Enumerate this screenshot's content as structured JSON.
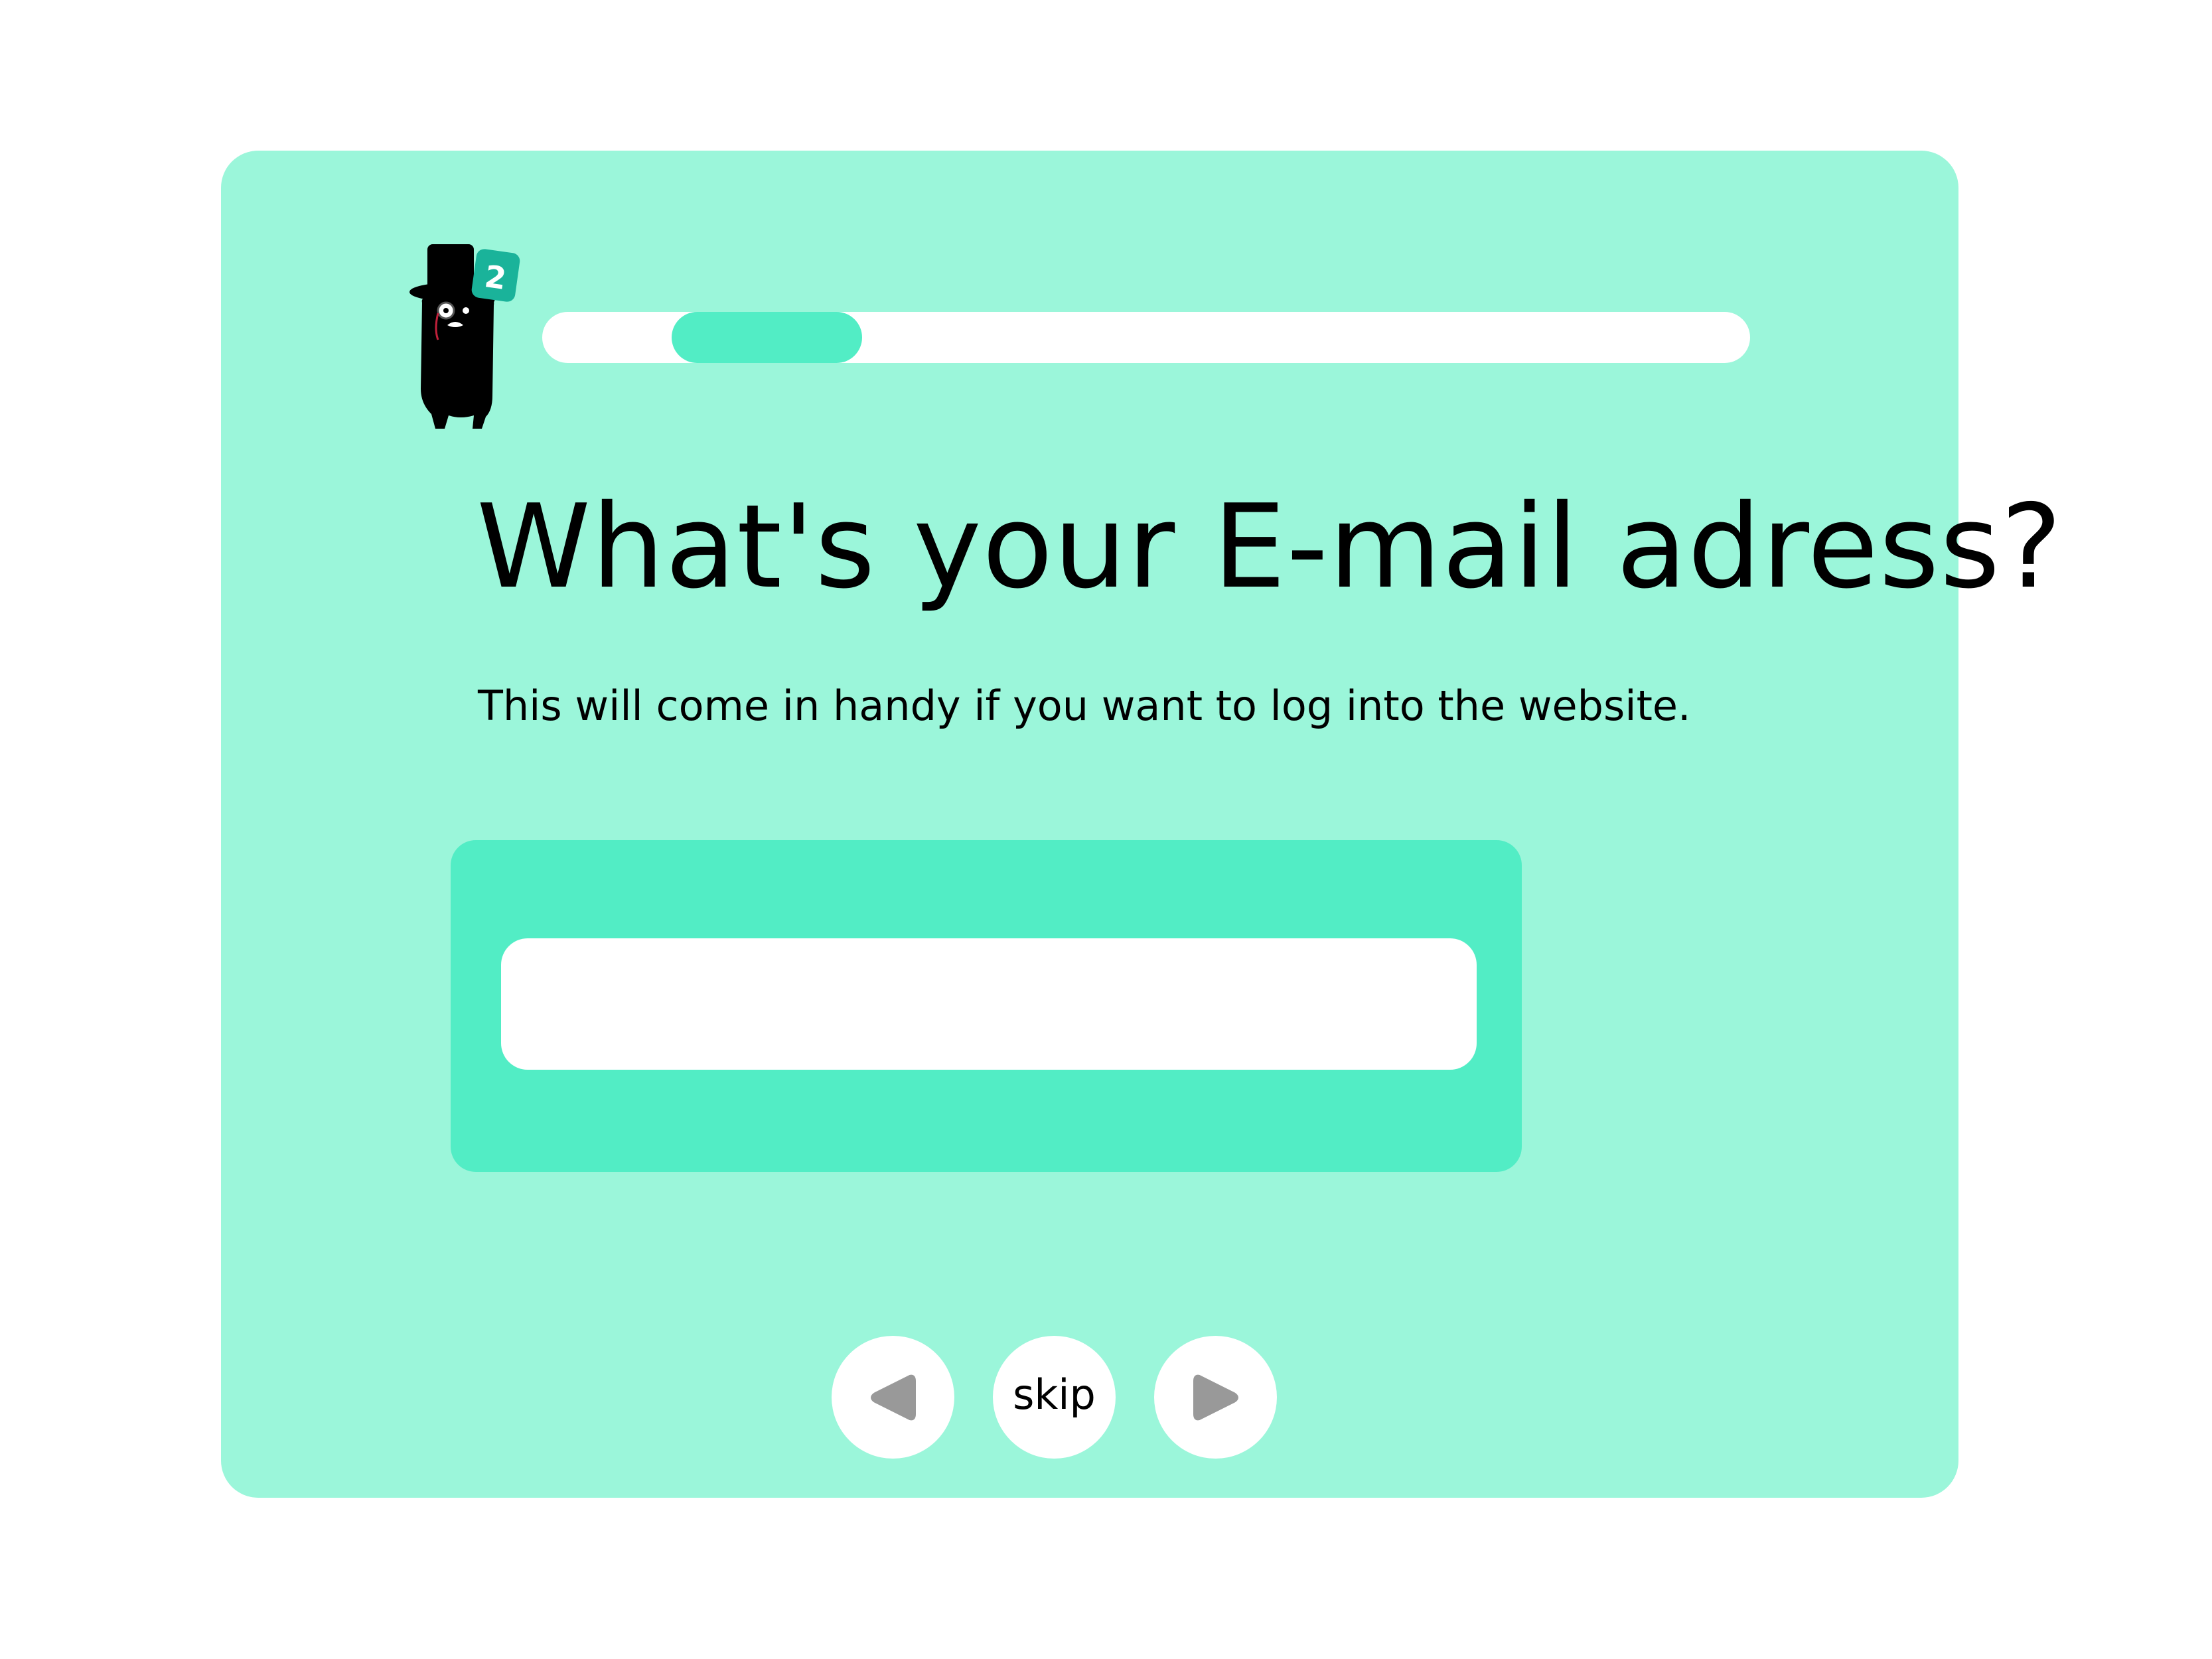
{
  "colors": {
    "card_bg": "#9bf6da",
    "accent": "#52edc5",
    "badge": "#1ab39a",
    "arrow": "#999999",
    "text": "#000000"
  },
  "progress": {
    "step": "2",
    "value_start": 0.107,
    "value_end": 0.265
  },
  "question": {
    "title": "What's your E-mail adress?",
    "subtitle": "This will come in handy if you want to log into the website."
  },
  "email_field": {
    "value": "",
    "placeholder": ""
  },
  "nav": {
    "back_icon": "arrow-left-icon",
    "skip_label": "skip",
    "next_icon": "arrow-right-icon"
  },
  "mascot": {
    "icon": "top-hat-cat-mascot-icon"
  }
}
